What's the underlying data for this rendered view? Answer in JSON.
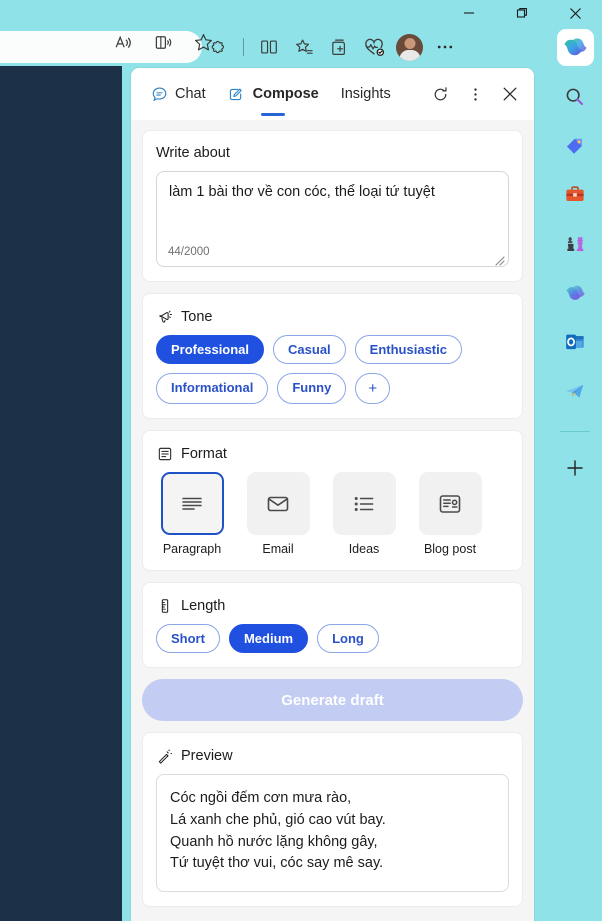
{
  "window": {
    "minimize_label": "Minimize",
    "restore_label": "Restore",
    "close_label": "Close"
  },
  "browser_toolbar": {
    "icons": [
      {
        "name": "read-aloud-icon",
        "label": "Read aloud"
      },
      {
        "name": "immersive-reader-icon",
        "label": "Enter Immersive Reader"
      },
      {
        "name": "favorite-star-icon",
        "label": "Add this page to favorites"
      },
      {
        "name": "extensions-icon",
        "label": "Extensions"
      },
      {
        "name": "split-screen-icon",
        "label": "Split screen"
      },
      {
        "name": "favorites-list-icon",
        "label": "Favorites"
      },
      {
        "name": "collections-icon",
        "label": "Collections"
      },
      {
        "name": "browser-essentials-icon",
        "label": "Browser essentials"
      },
      {
        "name": "avatar",
        "label": "Profile"
      },
      {
        "name": "settings-more-icon",
        "label": "Settings and more"
      },
      {
        "name": "copilot-icon",
        "label": "Copilot"
      }
    ]
  },
  "sidebar": {
    "items": [
      {
        "name": "sidebar-item-search",
        "icon": "search-icon",
        "label": "Search"
      },
      {
        "name": "sidebar-item-shopping",
        "icon": "shopping-tag-icon",
        "label": "Shopping"
      },
      {
        "name": "sidebar-item-tools",
        "icon": "tools-briefcase-icon",
        "label": "Tools"
      },
      {
        "name": "sidebar-item-games",
        "icon": "games-chess-icon",
        "label": "Games"
      },
      {
        "name": "sidebar-item-copilot",
        "icon": "copilot-icon",
        "label": "Copilot"
      },
      {
        "name": "sidebar-item-outlook",
        "icon": "outlook-icon",
        "label": "Outlook"
      },
      {
        "name": "sidebar-item-telegram",
        "icon": "paper-plane-icon",
        "label": "Telegram"
      }
    ],
    "add_label": "+"
  },
  "panel": {
    "tabs": [
      {
        "label": "Chat",
        "icon": "chat-bubble-icon",
        "active": false
      },
      {
        "label": "Compose",
        "icon": "compose-pencil-icon",
        "active": true
      },
      {
        "label": "Insights",
        "icon": "",
        "active": false
      }
    ],
    "actions": [
      {
        "name": "refresh-button",
        "label": "Refresh"
      },
      {
        "name": "more-options-button",
        "label": "More options"
      },
      {
        "name": "close-panel-button",
        "label": "Close"
      }
    ]
  },
  "write_about": {
    "title": "Write about",
    "value": "làm 1 bài thơ về con cóc, thể loại tứ tuyệt",
    "placeholder": "Write about",
    "counter": "44/2000",
    "max_chars": 2000,
    "used_chars": 44
  },
  "tone": {
    "title": "Tone",
    "icon": "megaphone-icon",
    "options": [
      {
        "label": "Professional",
        "selected": true
      },
      {
        "label": "Casual",
        "selected": false
      },
      {
        "label": "Enthusiastic",
        "selected": false
      },
      {
        "label": "Informational",
        "selected": false
      },
      {
        "label": "Funny",
        "selected": false
      }
    ],
    "add_label": "+"
  },
  "format": {
    "title": "Format",
    "icon": "document-lines-icon",
    "options": [
      {
        "label": "Paragraph",
        "icon": "paragraph-lines-icon",
        "selected": true
      },
      {
        "label": "Email",
        "icon": "envelope-icon",
        "selected": false
      },
      {
        "label": "Ideas",
        "icon": "bullet-list-icon",
        "selected": false
      },
      {
        "label": "Blog post",
        "icon": "blog-post-icon",
        "selected": false
      }
    ]
  },
  "length": {
    "title": "Length",
    "icon": "ruler-icon",
    "options": [
      {
        "label": "Short",
        "selected": false
      },
      {
        "label": "Medium",
        "selected": true
      },
      {
        "label": "Long",
        "selected": false
      }
    ]
  },
  "generate": {
    "label": "Generate draft",
    "disabled": true
  },
  "preview": {
    "title": "Preview",
    "icon": "magic-wand-icon",
    "lines": [
      "Cóc ngồi đếm cơn mưa rào,",
      "Lá xanh che phủ, gió cao vút bay.",
      "Quanh hồ nước lặng không gây,",
      "Tứ tuyệt thơ vui, cóc say mê say."
    ]
  },
  "colors": {
    "accent_blue": "#2050e0",
    "tab_underline": "#2565d8",
    "browser_teal": "#8fe3e8",
    "page_dark": "#1c3048",
    "panel_bg": "#f5f5f5",
    "disabled_button": "#c3cdf3"
  }
}
